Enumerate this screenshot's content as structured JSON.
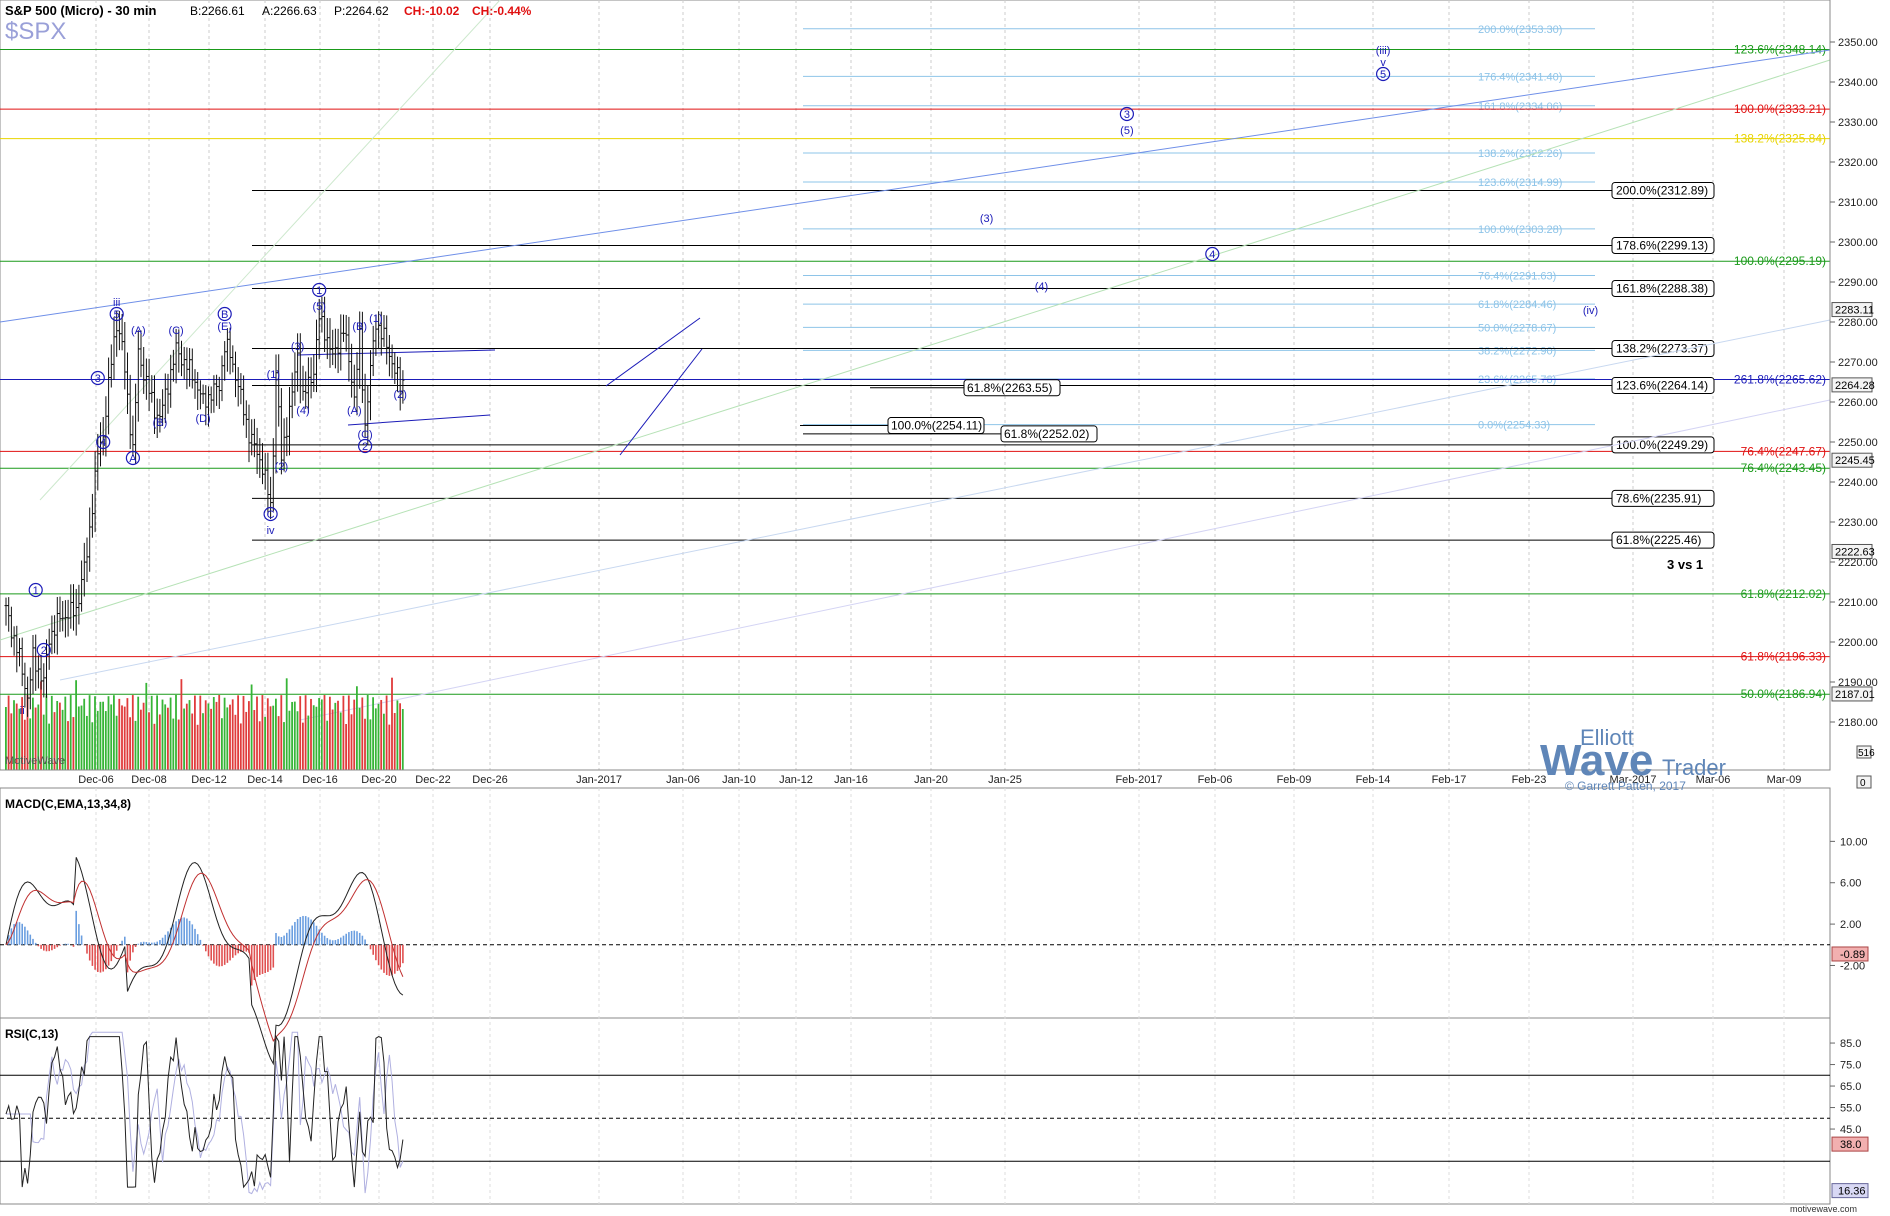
{
  "header": {
    "title": "S&P 500 (Micro) - 30 min",
    "bid": "B:2266.61",
    "ask": "A:2266.63",
    "price": "P:2264.62",
    "change": "CH:-10.02",
    "change_pct": "CH:-0.44%",
    "symbol": "$SPX"
  },
  "colors": {
    "wave": "#1b1bb8",
    "up": "#111111",
    "vol_up": "#37b537",
    "vol_down": "#e03b3b",
    "fib_red": "#e01010",
    "fib_green": "#1a9a1a",
    "fib_yellow": "#e8d400",
    "fib_light": "#8ec4e8",
    "fib_black": "#000000",
    "macd_hist_up": "#6a9ee0",
    "macd_hist_down": "#e05050",
    "rsi_fill": "#b8b8e8"
  },
  "logo": {
    "line1": "Elliott",
    "line2": "Wave",
    "line3": "Trader",
    "copyright": "© Garrett Patten, 2017"
  },
  "brand": "MotiveWave",
  "site": "motivewave.com",
  "note_3v1": "3 vs 1",
  "chart_data": {
    "type": "candlestick",
    "price_axis": {
      "ylim": [
        2170,
        2360
      ],
      "ticks": [
        2180,
        2190,
        2200,
        2210,
        2220,
        2230,
        2240,
        2250,
        2260,
        2270,
        2280,
        2290,
        2300,
        2310,
        2320,
        2330,
        2340,
        2350
      ],
      "price_tags": [
        {
          "value": 2283.11,
          "label": "2283.11"
        },
        {
          "value": 2264.28,
          "label": "2264.28"
        },
        {
          "value": 2245.45,
          "label": "2245.45"
        },
        {
          "value": 2222.63,
          "label": "2222.63"
        },
        {
          "value": 2187.01,
          "label": "2187.01"
        }
      ],
      "volume_tags": [
        "516",
        "0"
      ]
    },
    "x_axis_labels": [
      "Dec-06",
      "Dec-08",
      "Dec-12",
      "Dec-14",
      "Dec-16",
      "Dec-20",
      "Dec-22",
      "Dec-26",
      "Jan-2017",
      "Jan-06",
      "Jan-10",
      "Jan-12",
      "Jan-16",
      "Jan-20",
      "Jan-25",
      "Feb-2017",
      "Feb-06",
      "Feb-09",
      "Feb-14",
      "Feb-17",
      "Feb-23",
      "Mar-2017",
      "Mar-06",
      "Mar-09"
    ],
    "right_fib_levels": [
      {
        "value": 2348.14,
        "label": "123.6%(2348.14)",
        "color": "green"
      },
      {
        "value": 2333.21,
        "label": "100.0%(2333.21)",
        "color": "red"
      },
      {
        "value": 2325.84,
        "label": "138.2%(2325.84)",
        "color": "yellow"
      },
      {
        "value": 2295.19,
        "label": "100.0%(2295.19)",
        "color": "green"
      },
      {
        "value": 2265.62,
        "label": "261.8%(2265.62)",
        "color": "blue"
      },
      {
        "value": 2247.67,
        "label": "76.4%(2247.67)",
        "color": "red"
      },
      {
        "value": 2243.45,
        "label": "76.4%(2243.45)",
        "color": "green"
      },
      {
        "value": 2212.02,
        "label": "61.8%(2212.02)",
        "color": "green"
      },
      {
        "value": 2196.33,
        "label": "61.8%(2196.33)",
        "color": "red"
      },
      {
        "value": 2186.94,
        "label": "50.0%(2186.94)",
        "color": "green"
      }
    ],
    "light_fib_levels": [
      {
        "value": 2353.3,
        "label": "200.0%(2353.30)"
      },
      {
        "value": 2341.4,
        "label": "176.4%(2341.40)"
      },
      {
        "value": 2334.06,
        "label": "161.8%(2334.06)"
      },
      {
        "value": 2322.26,
        "label": "138.2%(2322.26)"
      },
      {
        "value": 2314.99,
        "label": "123.6%(2314.99)"
      },
      {
        "value": 2303.28,
        "label": "100.0%(2303.28)"
      },
      {
        "value": 2291.63,
        "label": "76.4%(2291.63)"
      },
      {
        "value": 2284.46,
        "label": "61.8%(2284.46)"
      },
      {
        "value": 2278.67,
        "label": "50.0%(2278.67)"
      },
      {
        "value": 2272.9,
        "label": "38.2%(2272.90)"
      },
      {
        "value": 2265.78,
        "label": "23.6%(2265.78)"
      },
      {
        "value": 2254.33,
        "label": "0.0%(2254.33)"
      }
    ],
    "box_fib_levels": [
      {
        "value": 2312.89,
        "label": "200.0%(2312.89)"
      },
      {
        "value": 2299.13,
        "label": "178.6%(2299.13)"
      },
      {
        "value": 2288.38,
        "label": "161.8%(2288.38)"
      },
      {
        "value": 2273.37,
        "label": "138.2%(2273.37)"
      },
      {
        "value": 2264.14,
        "label": "123.6%(2264.14)"
      },
      {
        "value": 2249.29,
        "label": "100.0%(2249.29)"
      },
      {
        "value": 2235.91,
        "label": "78.6%(2235.91)"
      },
      {
        "value": 2225.46,
        "label": "61.8%(2225.46)"
      }
    ],
    "small_boxes": [
      {
        "value": 2263.55,
        "label": "61.8%(2263.55)"
      },
      {
        "value": 2254.11,
        "label": "100.0%(2254.11)"
      },
      {
        "value": 2252.02,
        "label": "61.8%(2252.02)"
      }
    ],
    "wave_labels": [
      {
        "t": "iii",
        "bar": 41,
        "price": 2284
      },
      {
        "t": "5",
        "bar": 41,
        "price": 2281,
        "circle": true
      },
      {
        "t": "3",
        "bar": 34,
        "price": 2265,
        "circle": true
      },
      {
        "t": "4",
        "bar": 36,
        "price": 2249,
        "circle": true
      },
      {
        "t": "1",
        "bar": 11,
        "price": 2212,
        "circle": true
      },
      {
        "t": "2",
        "bar": 14,
        "price": 2197,
        "circle": true
      },
      {
        "t": "ii",
        "bar": 6,
        "price": 2182
      },
      {
        "t": "(A)",
        "bar": 49,
        "price": 2277
      },
      {
        "t": "A",
        "bar": 47,
        "price": 2245,
        "circle": true
      },
      {
        "t": "(B)",
        "bar": 57,
        "price": 2254
      },
      {
        "t": "(C)",
        "bar": 63,
        "price": 2277
      },
      {
        "t": "(D)",
        "bar": 73,
        "price": 2255
      },
      {
        "t": "B",
        "bar": 81,
        "price": 2281,
        "circle": true
      },
      {
        "t": "(E)",
        "bar": 81,
        "price": 2278
      },
      {
        "t": "C",
        "bar": 98,
        "price": 2231,
        "circle": true
      },
      {
        "t": "iv",
        "bar": 98,
        "price": 2227
      },
      {
        "t": "(1)",
        "bar": 99,
        "price": 2266
      },
      {
        "t": "(2)",
        "bar": 102,
        "price": 2243
      },
      {
        "t": "(3)",
        "bar": 108,
        "price": 2273
      },
      {
        "t": "(4)",
        "bar": 110,
        "price": 2257
      },
      {
        "t": "(5)",
        "bar": 116,
        "price": 2283
      },
      {
        "t": "1",
        "bar": 116,
        "price": 2287,
        "circle": true
      },
      {
        "t": "(A)",
        "bar": 129,
        "price": 2257
      },
      {
        "t": "(B)",
        "bar": 131,
        "price": 2278
      },
      {
        "t": "(C)",
        "bar": 133,
        "price": 2251
      },
      {
        "t": "2",
        "bar": 133,
        "price": 2248,
        "circle": true
      },
      {
        "t": "(1)",
        "bar": 137,
        "price": 2280
      },
      {
        "t": "(2)",
        "bar": 146,
        "price": 2261
      },
      {
        "t": "(iii)",
        "bar": 231,
        "price": 2347
      },
      {
        "t": "v",
        "bar": 231,
        "price": 2344
      },
      {
        "t": "5",
        "bar": 231,
        "price": 2341,
        "circle": true
      },
      {
        "t": "3",
        "bar": 189,
        "price": 2331,
        "circle": true
      },
      {
        "t": "(5)",
        "bar": 189,
        "price": 2327
      },
      {
        "t": "(3)",
        "bar": 166,
        "price": 2305
      },
      {
        "t": "4",
        "bar": 203,
        "price": 2296,
        "circle": true
      },
      {
        "t": "(4)",
        "bar": 175,
        "price": 2288
      },
      {
        "t": "(iv)",
        "bar": 265,
        "price": 2282
      }
    ],
    "macd": {
      "title": "MACD(C,EMA,13,34,8)",
      "ylim": [
        -6.5,
        14
      ],
      "ticks": [
        10.0,
        6.0,
        2.0,
        -2.0
      ],
      "tick_labels": [
        "10.00",
        "6.00",
        "2.00",
        "-2.00"
      ],
      "current": "-0.89",
      "current_value": -0.89
    },
    "rsi": {
      "title": "RSI(C,13)",
      "ylim": [
        12,
        92
      ],
      "ticks": [
        85,
        75,
        65,
        55,
        45
      ],
      "tick_labels": [
        "85.0",
        "75.0",
        "65.0",
        "55.0",
        "45.0"
      ],
      "levels": [
        70,
        50,
        30
      ],
      "current": "38.0",
      "current_value": 38.0,
      "current2": "16.36",
      "current2_value": 16.36
    }
  }
}
